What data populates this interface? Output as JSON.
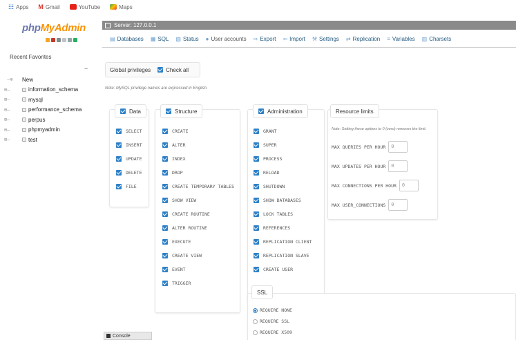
{
  "bookmarks": {
    "apps": "Apps",
    "gmail": "Gmail",
    "youtube": "YouTube",
    "maps": "Maps"
  },
  "sidebar": {
    "logo_php": "php",
    "logo_myadmin": "MyAdmin",
    "recent": "Recent",
    "favorites": "Favorites",
    "collapse": "−",
    "tree": [
      "New",
      "information_schema",
      "mysql",
      "performance_schema",
      "perpus",
      "phpmyadmin",
      "test"
    ]
  },
  "server": {
    "label": "Server: 127.0.0.1"
  },
  "tabs": [
    {
      "label": "Databases",
      "icon": "▤"
    },
    {
      "label": "SQL",
      "icon": "▦"
    },
    {
      "label": "Status",
      "icon": "▧"
    },
    {
      "label": "User accounts",
      "icon": "●"
    },
    {
      "label": "Export",
      "icon": "⇨"
    },
    {
      "label": "Import",
      "icon": "⇦"
    },
    {
      "label": "Settings",
      "icon": "⚒"
    },
    {
      "label": "Replication",
      "icon": "⇄"
    },
    {
      "label": "Variables",
      "icon": "≡"
    },
    {
      "label": "Charsets",
      "icon": "▥"
    }
  ],
  "global": {
    "title": "Global privileges",
    "check_all": "Check all",
    "note": "Note: MySQL privilege names are expressed in English."
  },
  "data_group": {
    "legend": "Data",
    "items": [
      "SELECT",
      "INSERT",
      "UPDATE",
      "DELETE",
      "FILE"
    ]
  },
  "structure_group": {
    "legend": "Structure",
    "items": [
      "CREATE",
      "ALTER",
      "INDEX",
      "DROP",
      "CREATE TEMPORARY TABLES",
      "SHOW VIEW",
      "CREATE ROUTINE",
      "ALTER ROUTINE",
      "EXECUTE",
      "CREATE VIEW",
      "EVENT",
      "TRIGGER"
    ]
  },
  "admin_group": {
    "legend": "Administration",
    "items": [
      "GRANT",
      "SUPER",
      "PROCESS",
      "RELOAD",
      "SHUTDOWN",
      "SHOW DATABASES",
      "LOCK TABLES",
      "REFERENCES",
      "REPLICATION CLIENT",
      "REPLICATION SLAVE",
      "CREATE USER"
    ]
  },
  "resource_limits": {
    "legend": "Resource limits",
    "note": "Note: Setting these options to 0 (zero) removes the limit.",
    "rows": [
      {
        "label": "MAX QUERIES PER HOUR",
        "value": "0"
      },
      {
        "label": "MAX UPDATES PER HOUR",
        "value": "0"
      },
      {
        "label": "MAX CONNECTIONS PER HOUR",
        "value": "0"
      },
      {
        "label": "MAX USER_CONNECTIONS",
        "value": "0"
      }
    ]
  },
  "ssl": {
    "legend": "SSL",
    "options": [
      "REQUIRE NONE",
      "REQUIRE SSL",
      "REQUIRE X509"
    ],
    "selected": "REQUIRE NONE"
  },
  "console": {
    "label": "Console"
  },
  "colors": {
    "accent": "#2e80c7",
    "link": "#235a81",
    "server_bar": "#8a8a8a",
    "logo_php": "#6c78af",
    "logo_myadmin": "#f89406"
  }
}
